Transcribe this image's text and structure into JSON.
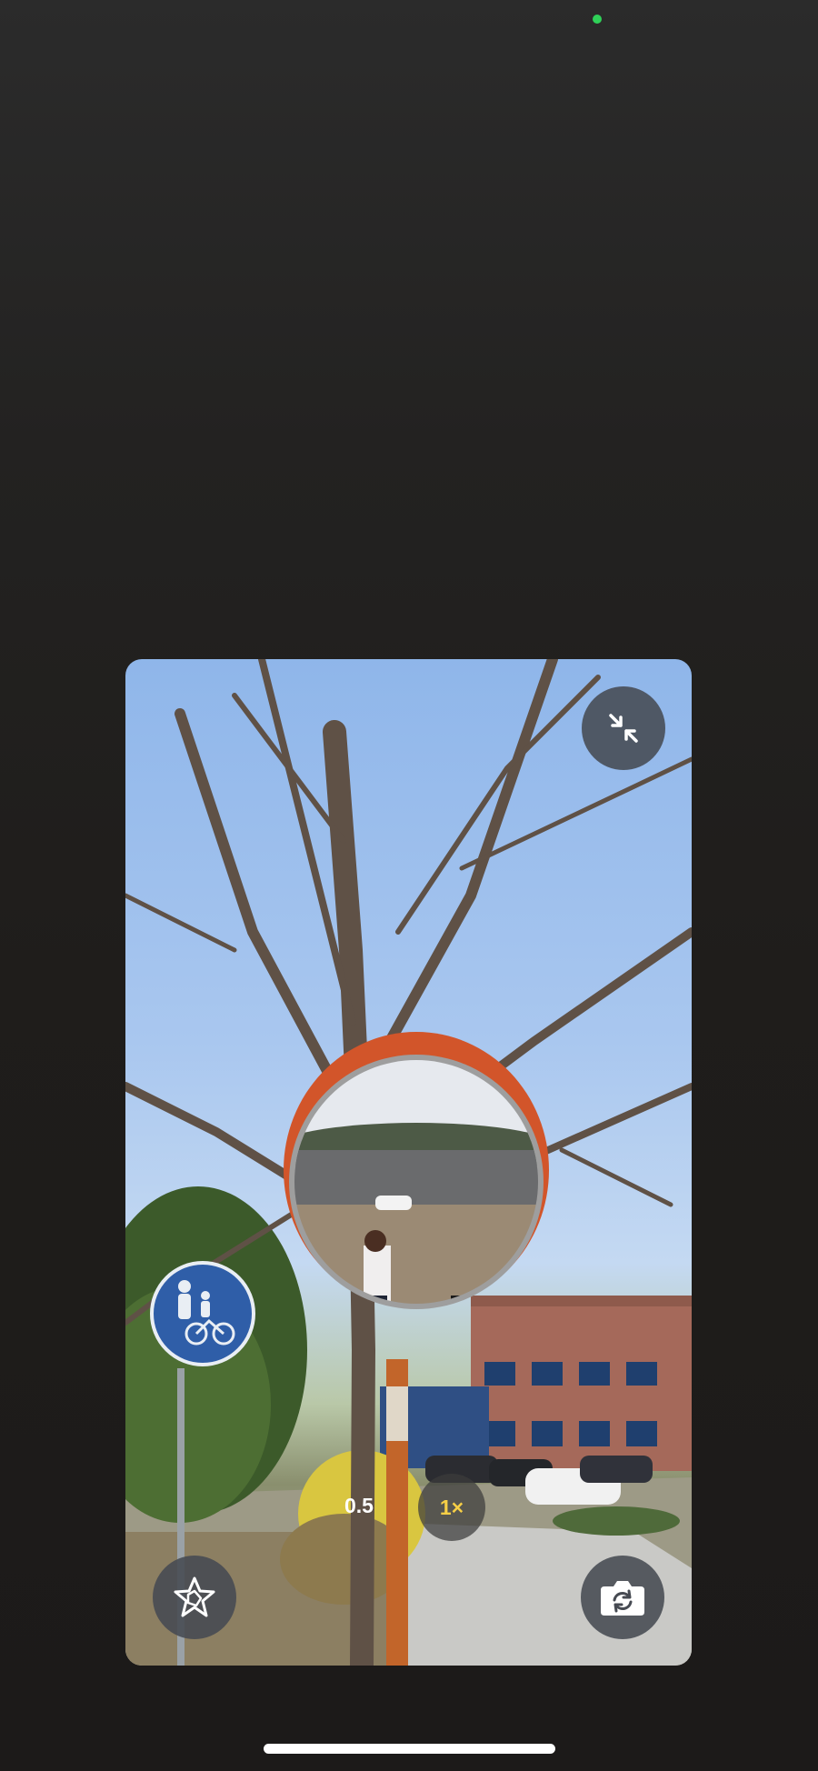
{
  "status": {
    "camera_indicator_color": "#2fd158"
  },
  "camera_preview": {
    "collapse_button": {
      "icon": "collapse-arrows-icon"
    },
    "zoom": {
      "option_1": "0.5",
      "option_2": "1×",
      "selected": "1×",
      "selected_color": "#f7cf46"
    },
    "effects_button": {
      "icon": "star-effects-icon"
    },
    "flip_camera_button": {
      "icon": "camera-flip-icon"
    }
  },
  "home_indicator_color": "#ffffff"
}
